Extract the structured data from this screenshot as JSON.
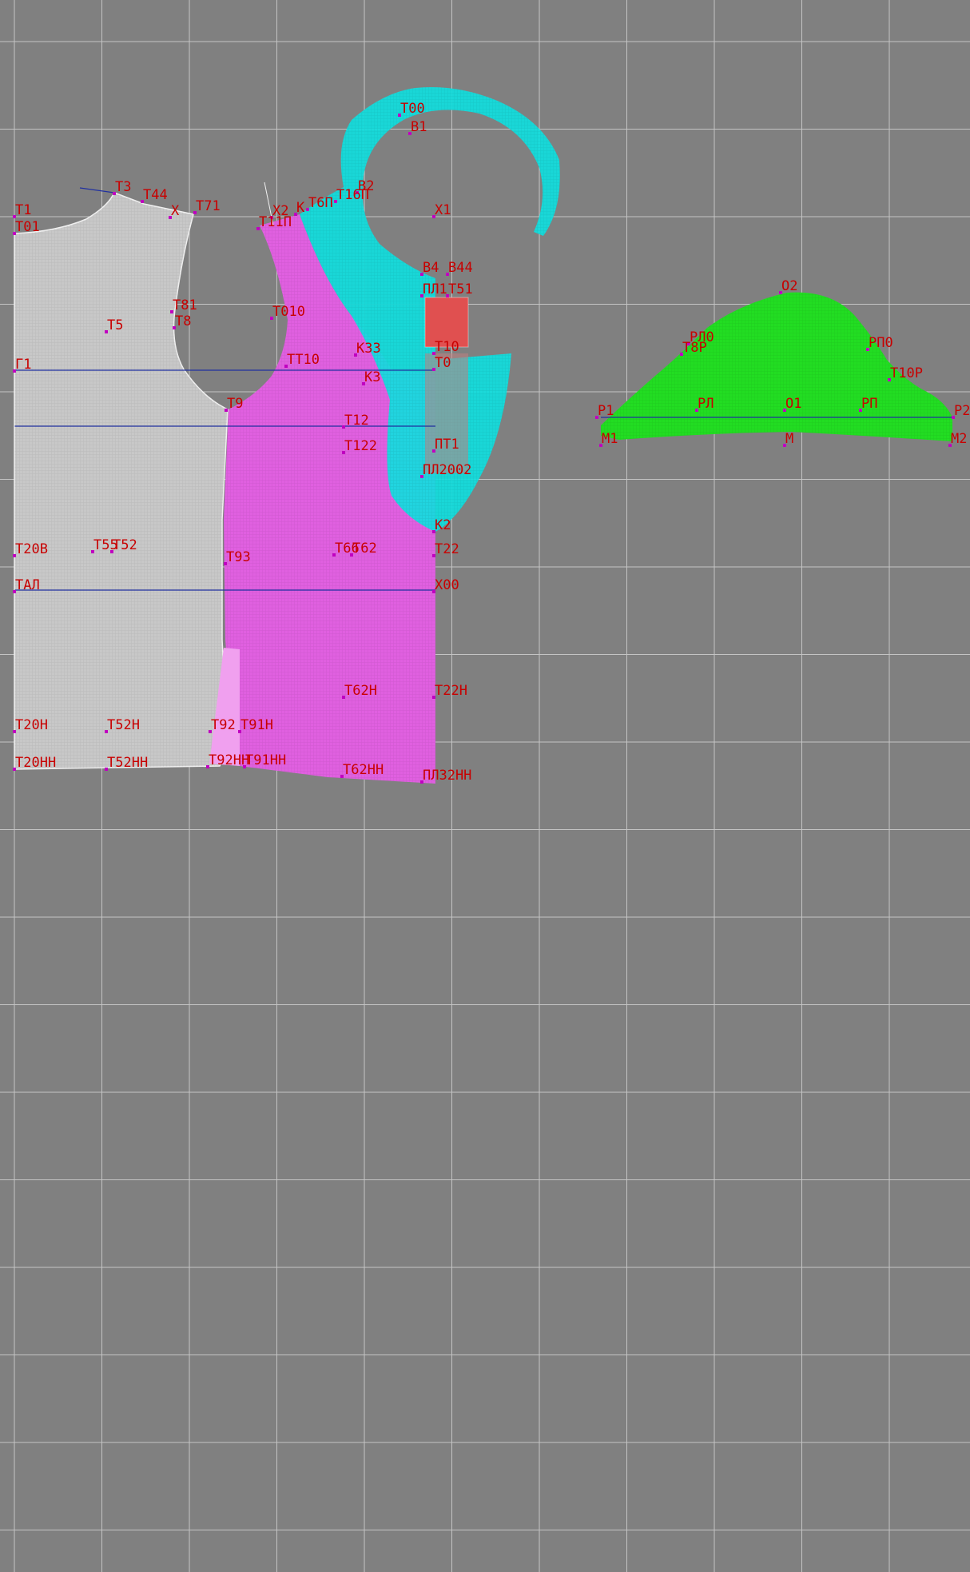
{
  "canvas": {
    "background": "#808080",
    "grid_color": "#c4c4c4"
  },
  "colors": {
    "back_piece": "#c8c8c8",
    "front_piece": "#e060e0",
    "facing_piece": "#10dede",
    "sleeve_piece": "#22dd22",
    "pocket_piece": "#e05050",
    "label": "#c80000",
    "point": "#c000c0",
    "construction_line": "#2030a0"
  },
  "pieces": [
    {
      "id": "back",
      "name": "back-piece"
    },
    {
      "id": "front",
      "name": "front-piece"
    },
    {
      "id": "facing",
      "name": "facing-piece"
    },
    {
      "id": "pocket",
      "name": "pocket-piece"
    },
    {
      "id": "sleeve",
      "name": "sleeve-piece"
    }
  ],
  "labels": [
    {
      "text": "Т00"
    },
    {
      "text": "В1"
    },
    {
      "text": "В2"
    },
    {
      "text": "Х1"
    },
    {
      "text": "Т1"
    },
    {
      "text": "Т01"
    },
    {
      "text": "Т3"
    },
    {
      "text": "Т44"
    },
    {
      "text": "Х"
    },
    {
      "text": "Т71"
    },
    {
      "text": "Х2"
    },
    {
      "text": "К"
    },
    {
      "text": "Т6П"
    },
    {
      "text": "Т16П"
    },
    {
      "text": "Т11П"
    },
    {
      "text": "В4"
    },
    {
      "text": "В44"
    },
    {
      "text": "ПЛ1"
    },
    {
      "text": "Т51"
    },
    {
      "text": "Т81"
    },
    {
      "text": "Т8"
    },
    {
      "text": "Т5"
    },
    {
      "text": "Т010"
    },
    {
      "text": "К33"
    },
    {
      "text": "ТТ10"
    },
    {
      "text": "Т10"
    },
    {
      "text": "Т0"
    },
    {
      "text": "К3"
    },
    {
      "text": "Г1"
    },
    {
      "text": "Т9"
    },
    {
      "text": "Т12"
    },
    {
      "text": "Т122"
    },
    {
      "text": "ПТ1"
    },
    {
      "text": "ПЛ2002"
    },
    {
      "text": "К2"
    },
    {
      "text": "Т20В"
    },
    {
      "text": "Т55"
    },
    {
      "text": "Т52"
    },
    {
      "text": "Т93"
    },
    {
      "text": "Т66"
    },
    {
      "text": "Т62"
    },
    {
      "text": "Т22"
    },
    {
      "text": "ТАЛ"
    },
    {
      "text": "Х00"
    },
    {
      "text": "Т62Н"
    },
    {
      "text": "Т22Н"
    },
    {
      "text": "Т20Н"
    },
    {
      "text": "Т52Н"
    },
    {
      "text": "Т92"
    },
    {
      "text": "Т91Н"
    },
    {
      "text": "Т20НН"
    },
    {
      "text": "Т52НН"
    },
    {
      "text": "Т92НН"
    },
    {
      "text": "Т91НН"
    },
    {
      "text": "Т62НН"
    },
    {
      "text": "ПЛ32НН"
    },
    {
      "text": "О2"
    },
    {
      "text": "РЛ0"
    },
    {
      "text": "Т8Р"
    },
    {
      "text": "РП0"
    },
    {
      "text": "Т10Р"
    },
    {
      "text": "Р1"
    },
    {
      "text": "РЛ"
    },
    {
      "text": "О1"
    },
    {
      "text": "РП"
    },
    {
      "text": "Р2"
    },
    {
      "text": "М1"
    },
    {
      "text": "М"
    },
    {
      "text": "М2"
    }
  ]
}
